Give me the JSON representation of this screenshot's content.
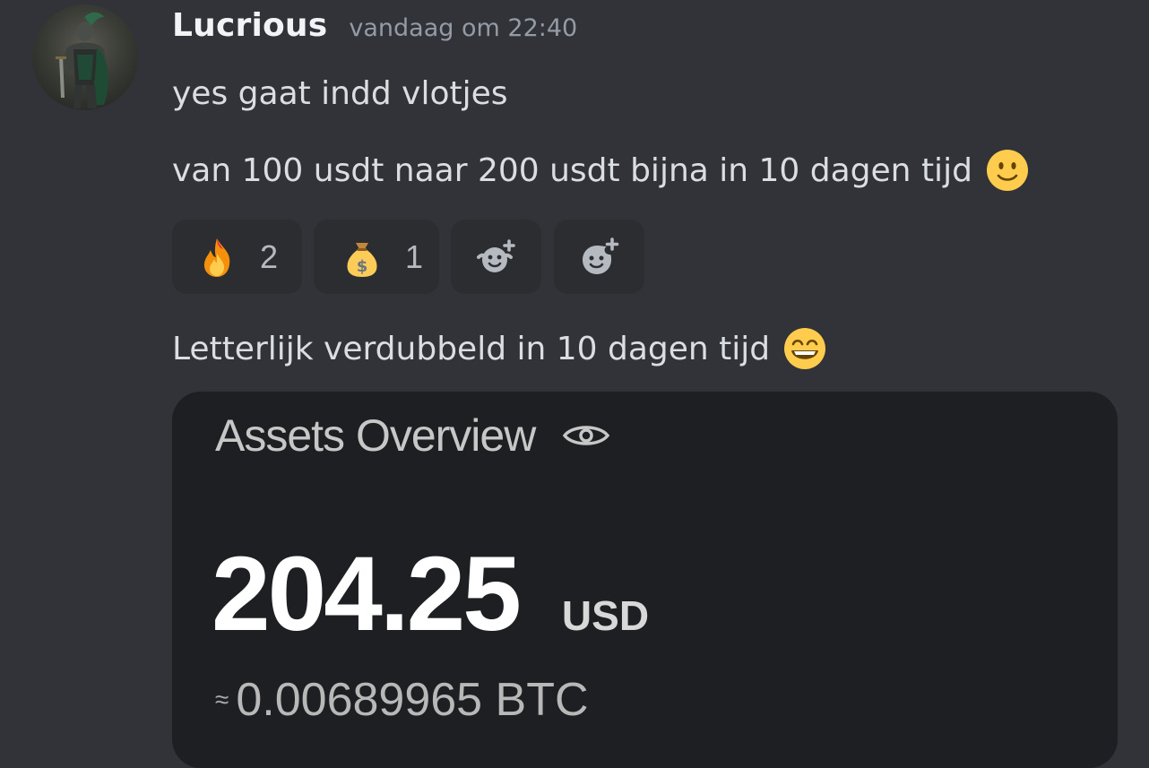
{
  "message": {
    "author": "Lucrious",
    "timestamp": "vandaag om 22:40",
    "lines": [
      "yes gaat indd vlotjes",
      "van 100 usdt naar 200 usdt bijna in 10 dagen tijd",
      "Letterlijk verdubbeld in 10 dagen tijd"
    ],
    "line_emojis": [
      "slightly-smiling-face",
      "grinning-face-with-smiling-eyes"
    ]
  },
  "reactions": [
    {
      "emoji": "fire",
      "count": "2"
    },
    {
      "emoji": "money-bag",
      "count": "1"
    },
    {
      "emoji": "add-super-reaction",
      "count": ""
    },
    {
      "emoji": "add-reaction",
      "count": ""
    }
  ],
  "embed": {
    "title": "Assets Overview",
    "balance_value": "204.25",
    "balance_unit": "USD",
    "approx_symbol": "≈",
    "btc_value": "0.00689965 BTC"
  },
  "colors": {
    "background": "#313338",
    "reaction_bg": "#2b2d31",
    "embed_bg": "#1e1f22",
    "username": "#f2f3f5",
    "timestamp": "#949ba4",
    "text": "#dbdee1"
  }
}
